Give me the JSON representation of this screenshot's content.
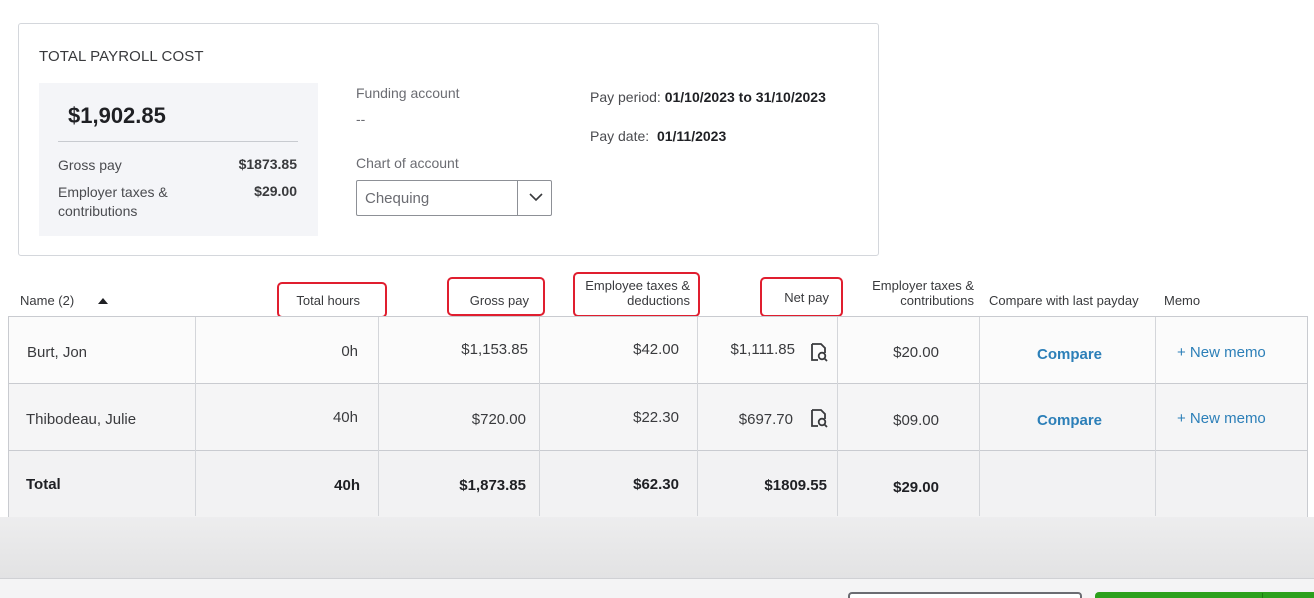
{
  "summary": {
    "title": "TOTAL PAYROLL COST",
    "total": "$1,902.85",
    "gross_pay_label": "Gross pay",
    "gross_pay_value": "$1873.85",
    "employer_label": "Employer taxes & contributions",
    "employer_value": "$29.00",
    "funding_account_label": "Funding account",
    "funding_account_value": "--",
    "chart_of_account_label": "Chart of account",
    "chart_of_account_value": "Chequing",
    "pay_period_label": "Pay period:",
    "pay_period_value": "01/10/2023 to 31/10/2023",
    "pay_date_label": "Pay date:",
    "pay_date_value": "01/11/2023"
  },
  "table": {
    "headers": {
      "name": "Name (2)",
      "total_hours": "Total hours",
      "gross_pay": "Gross pay",
      "employee_taxes_line1": "Employee taxes &",
      "employee_taxes_line2": "deductions",
      "net_pay": "Net pay",
      "employer_taxes_line1": "Employer taxes &",
      "employer_taxes_line2": "contributions",
      "compare": "Compare with last payday",
      "memo": "Memo"
    },
    "rows": [
      {
        "name": "Burt, Jon",
        "hours": "0h",
        "gross": "$1,153.85",
        "employee_taxes": "$42.00",
        "net": "$1,111.85",
        "employer_taxes": "$20.00",
        "compare": "Compare",
        "memo": "+ New memo"
      },
      {
        "name": "Thibodeau, Julie",
        "hours": "40h",
        "gross": "$720.00",
        "employee_taxes": "$22.30",
        "net": "$697.70",
        "employer_taxes": "$09.00",
        "compare": "Compare",
        "memo": "+ New memo"
      }
    ],
    "total": {
      "label": "Total",
      "hours": "40h",
      "gross": "$1,873.85",
      "employee_taxes": "$62.30",
      "net": "$1809.55",
      "employer_taxes": "$29.00"
    }
  },
  "colors": {
    "highlight": "#e01e2f",
    "link": "#2c7fb8",
    "primary_button": "#2ca01c"
  },
  "icons": [
    "sort-ascending-icon",
    "chevron-down-icon",
    "document-search-icon"
  ]
}
